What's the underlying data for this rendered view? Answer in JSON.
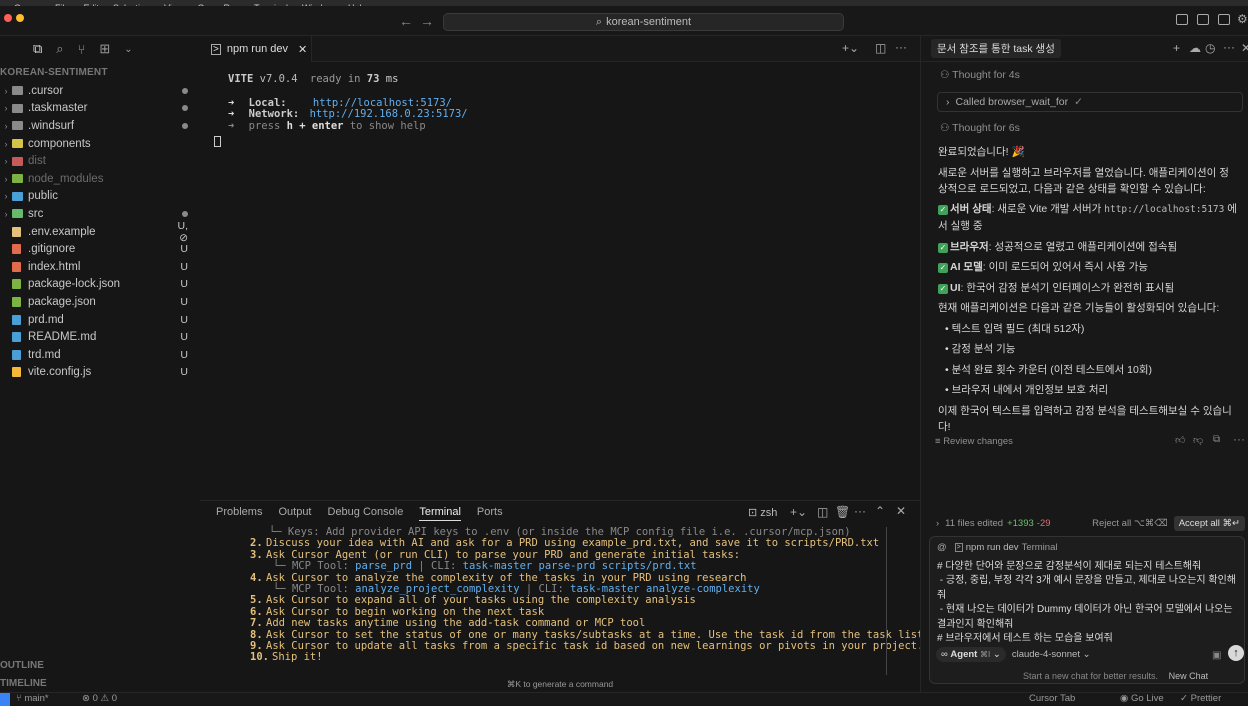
{
  "menubar": {
    "items": [
      "Cursor",
      "File",
      "Edit",
      "Selection",
      "View",
      "Go",
      "Run",
      "Terminal",
      "Window",
      "Help"
    ]
  },
  "titlebar": {
    "search_text": "korean-sentiment"
  },
  "explorer": {
    "workspace_title": "KOREAN-SENTIMENT",
    "items": [
      {
        "name": ".cursor",
        "type": "folder",
        "status": "dot",
        "color": "#c8c8c8"
      },
      {
        "name": ".taskmaster",
        "type": "folder",
        "status": "dot",
        "color": "#c8c8c8"
      },
      {
        "name": ".windsurf",
        "type": "folder",
        "status": "dot",
        "color": "#c8c8c8"
      },
      {
        "name": "components",
        "type": "folder",
        "status": "",
        "color": "#c8c8c8"
      },
      {
        "name": "dist",
        "type": "folder",
        "status": "",
        "color": "#6c6c6c"
      },
      {
        "name": "node_modules",
        "type": "folder",
        "status": "",
        "color": "#6c6c6c"
      },
      {
        "name": "public",
        "type": "folder",
        "status": "",
        "color": "#c8c8c8"
      },
      {
        "name": "src",
        "type": "folder",
        "status": "dot",
        "color": "#c8c8c8"
      },
      {
        "name": ".env.example",
        "type": "file",
        "status": "U, ⊘",
        "color": "#c8c8c8"
      },
      {
        "name": ".gitignore",
        "type": "file",
        "status": "U",
        "color": "#c8c8c8"
      },
      {
        "name": "index.html",
        "type": "file",
        "status": "U",
        "color": "#c8c8c8"
      },
      {
        "name": "package-lock.json",
        "type": "file",
        "status": "U",
        "color": "#c8c8c8"
      },
      {
        "name": "package.json",
        "type": "file",
        "status": "U",
        "color": "#c8c8c8"
      },
      {
        "name": "prd.md",
        "type": "file",
        "status": "U",
        "color": "#c8c8c8"
      },
      {
        "name": "README.md",
        "type": "file",
        "status": "U",
        "color": "#c8c8c8"
      },
      {
        "name": "trd.md",
        "type": "file",
        "status": "U",
        "color": "#c8c8c8"
      },
      {
        "name": "vite.config.js",
        "type": "file",
        "status": "U",
        "color": "#c8c8c8"
      }
    ],
    "outline_label": "OUTLINE",
    "timeline_label": "TIMELINE"
  },
  "editor": {
    "tab_label": "npm run dev",
    "vite": {
      "name": "VITE",
      "version": "v7.0.4",
      "ready_text": "ready in",
      "ms": "73",
      "ms_unit": "ms"
    },
    "local_label": "Local:",
    "local_url": "http://localhost:5173/",
    "network_label": "Network:",
    "network_url": "http://192.168.0.23:5173/",
    "help_prefix": "press",
    "help_key": "h + enter",
    "help_suffix": "to show help"
  },
  "panel": {
    "tabs": [
      "Problems",
      "Output",
      "Debug Console",
      "Terminal",
      "Ports"
    ],
    "active_tab": "Terminal",
    "shell": "zsh",
    "hint": "⌘K to generate a command",
    "lines": [
      {
        "text": "   └─ Keys: Add provider API keys to .env (or inside the MCP config file i.e. .cursor/mcp.json)",
        "cls": "dim"
      },
      {
        "num": "2.",
        "text": "Discuss your idea with AI and ask for a PRD using example_prd.txt, and save it to scripts/PRD.txt",
        "cls": "yellow"
      },
      {
        "num": "3.",
        "text": "Ask Cursor Agent (or run CLI) to parse your PRD and generate initial tasks:",
        "cls": "yellow"
      },
      {
        "sub": true,
        "tool": "MCP Tool:",
        "tool_val": "parse_prd",
        "cli": "CLI:",
        "cli_val": "task-master parse-prd scripts/prd.txt"
      },
      {
        "num": "4.",
        "text": "Ask Cursor to analyze the complexity of the tasks in your PRD using research",
        "cls": "yellow"
      },
      {
        "sub": true,
        "tool": "MCP Tool:",
        "tool_val": "analyze_project_complexity",
        "cli": "CLI:",
        "cli_val": "task-master analyze-complexity"
      },
      {
        "num": "5.",
        "text": "Ask Cursor to expand all of your tasks using the complexity analysis",
        "cls": "yellow"
      },
      {
        "num": "6.",
        "text": "Ask Cursor to begin working on the next task",
        "cls": "yellow"
      },
      {
        "num": "7.",
        "text": "Add new tasks anytime using the add-task command or MCP tool",
        "cls": "yellow"
      },
      {
        "num": "8.",
        "text": "Ask Cursor to set the status of one or many tasks/subtasks at a time. Use the task id from the task lists.",
        "cls": "yellow"
      },
      {
        "num": "9.",
        "text": "Ask Cursor to update all tasks from a specific task id based on new learnings or pivots in your project.",
        "cls": "yellow"
      },
      {
        "num": "10.",
        "text": "Ship it!",
        "cls": "yellow"
      }
    ]
  },
  "chat": {
    "title": "문서 참조를 통한 task 생성",
    "thought1": "Thought for 4s",
    "tool_call": "Called browser_wait_for",
    "thought2": "Thought for 6s",
    "done": "완료되었습니다! 🎉",
    "intro": "새로운 서버를 실행하고 브라우저를 열었습니다. 애플리케이션이 정상적으로 로드되었고, 다음과 같은 상태를 확인할 수 있습니다:",
    "checks": [
      {
        "label": "서버 상태",
        "pre": ": 새로운 Vite 개발 서버가 ",
        "code": "http://localhost:5173",
        "post": " 에서 실행 중"
      },
      {
        "label": "브라우저",
        "pre": ": 성공적으로 열렸고 애플리케이션에 접속됨",
        "code": "",
        "post": ""
      },
      {
        "label": "AI 모델",
        "pre": ": 이미 로드되어 있어서 즉시 사용 가능",
        "code": "",
        "post": ""
      },
      {
        "label": "UI",
        "pre": ": 한국어 감정 분석기 인터페이스가 완전히 표시됨",
        "code": "",
        "post": ""
      }
    ],
    "features_intro": "현재 애플리케이션은 다음과 같은 기능들이 활성화되어 있습니다:",
    "features": [
      "텍스트 입력 필드 (최대 512자)",
      "감정 분석 기능",
      "분석 완료 횟수 카운터 (이전 테스트에서 10회)",
      "브라우저 내에서 개인정보 보호 처리"
    ],
    "closing": "이제 한국어 텍스트를 입력하고 감정 분석을 테스트해보실 수 있습니다!",
    "review": "Review changes",
    "files_edited": "11 files edited",
    "added": "+1393",
    "removed": "-29",
    "reject_all": "Reject all ⌥⌘⌫",
    "accept_all": "Accept all ⌘↵",
    "context_chip": "npm run dev",
    "context_chip_kind": "Terminal",
    "prompt_lines": [
      "# 다양한 단어와 문장으로 감정분석이 제대로 되는지 테스트해줘",
      " - 긍정, 중립, 부정 각각 3개 예시 문장을 만들고, 제대로 나오는지 확인해줘",
      " - 현재 나오는 데이터가 Dummy 데이터가 아닌 한국어 모델에서 나오는 결과인지 확인해줘",
      "# 브라우저에서 테스트 하는 모습을 보여줘"
    ],
    "agent_label": "Agent",
    "agent_shortcut": "⌘I",
    "model": "claude-4-sonnet",
    "footer_hint": "Start a new chat for better results.",
    "new_chat": "New Chat"
  },
  "statusbar": {
    "branch": "main*",
    "errors": "0",
    "warnings": "0",
    "cursor_tab": "Cursor Tab",
    "go_live": "Go Live",
    "prettier": "Prettier"
  },
  "colors": {
    "accent": "#3b82f6",
    "git_untracked": "#c7c7c7",
    "term_yellow": "#e5c07b",
    "term_blue": "#61afef"
  }
}
